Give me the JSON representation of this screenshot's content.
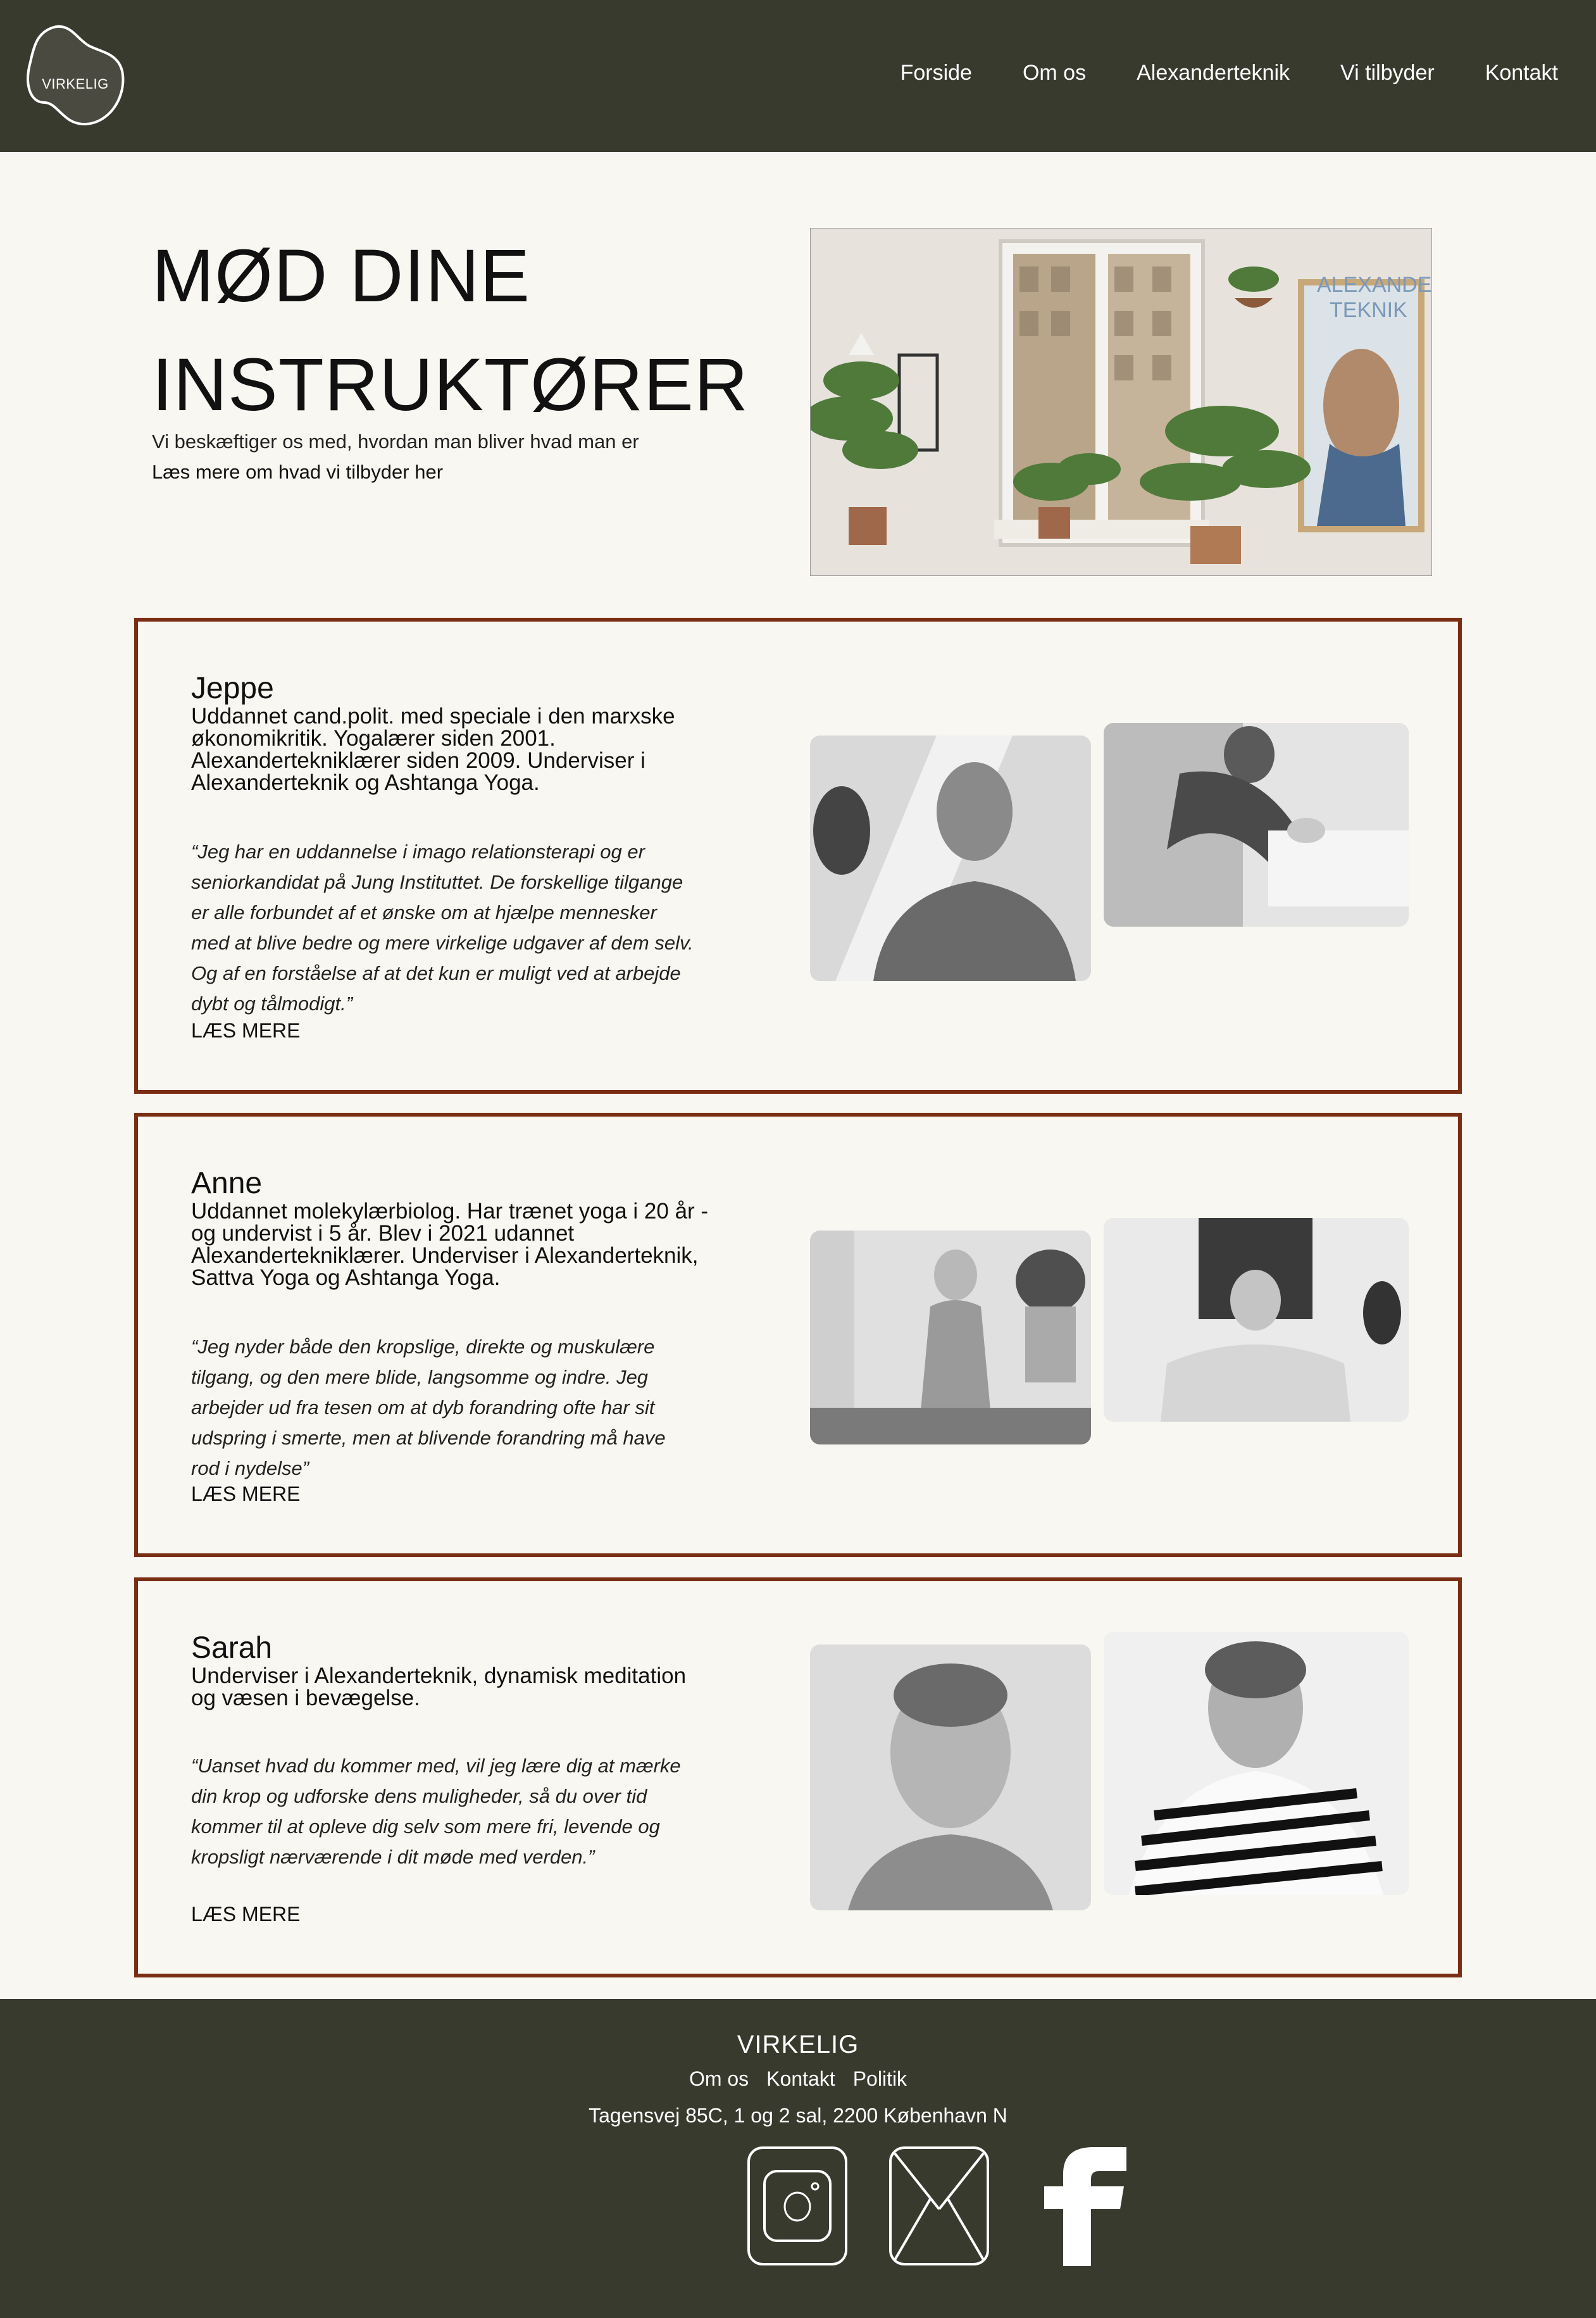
{
  "header": {
    "logo_text": "VIRKELIG",
    "nav": [
      "Forside",
      "Om os",
      "Alexanderteknik",
      "Vi tilbyder",
      "Kontakt"
    ]
  },
  "hero": {
    "title_line1": "MØD DINE",
    "title_line2": "INSTRUKTØRER",
    "subtitle": "Vi beskæftiger os med, hvordan man bliver hvad man er",
    "link": "Læs mere om hvad vi tilbyder her",
    "image_poster_text": "ALEXANDER TEKNIK"
  },
  "instructors": [
    {
      "name": "Jeppe",
      "bio": "Uddannet cand.polit. med speciale i den marxske økonomikritik. Yogalærer siden 2001. Alexanderteknik­lærer siden 2009. Underviser i Alexanderteknik og Ashtanga Yoga.",
      "quote": "“Jeg har en uddannelse i imago relationsterapi og er seniorkandidat på Jung Instituttet. De forskellige tilgange er alle forbundet af et ønske om at hjælpe mennesker med at blive bedre og mere virkelige udgaver af dem selv. Og af en forståelse af at det kun er muligt ved at arbejde dybt og tålmodigt.”",
      "more": "LÆS MERE"
    },
    {
      "name": "Anne",
      "bio": "Uddannet molekylærbiolog. Har trænet yoga i 20 år - og undervist i 5 år. Blev i 2021 udannet Alexanderteknik­lærer. Underviser i Alexanderteknik, Sattva Yoga og Ashtanga Yoga.",
      "quote": "“Jeg nyder både den kropslige, direkte og muskulære tilgang, og den mere blide, langsomme og indre. Jeg arbejder ud fra tesen om at dyb forandring ofte har sit udspring i smerte, men at blivende forandring må have rod i nydelse”",
      "more": "LÆS MERE"
    },
    {
      "name": "Sarah",
      "bio": "Underviser i Alexanderteknik, dynamisk meditation og væsen i bevægelse.",
      "quote": "“Uanset hvad du kommer med, vil jeg lære dig at mærke din krop og udforske dens muligheder, så du over tid kommer til at opleve dig selv som mere fri, levende og kropsligt nærværende i dit møde med verden.”",
      "more": "LÆS MERE"
    }
  ],
  "footer": {
    "brand": "VIRKELIG",
    "links": [
      "Om os",
      "Kontakt",
      "Politik"
    ],
    "address": "Tagensvej 85C, 1 og 2 sal, 2200 København N",
    "social": [
      "instagram-icon",
      "mail-icon",
      "facebook-icon"
    ]
  },
  "colors": {
    "header_bg": "#393a2e",
    "page_bg": "#f9f7f1",
    "card_border": "#7a2e14"
  }
}
